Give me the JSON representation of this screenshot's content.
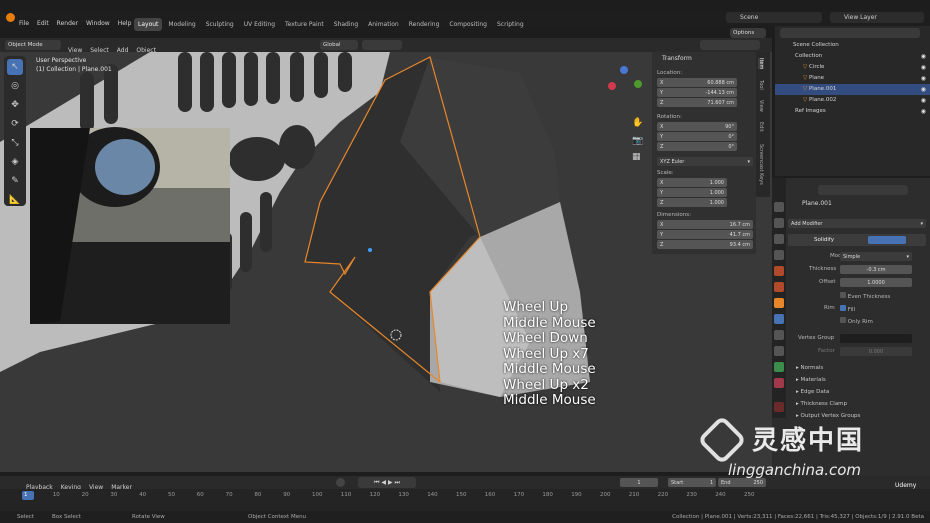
{
  "topbar": {
    "menus": [
      "File",
      "Edit",
      "Render",
      "Window",
      "Help"
    ],
    "workspaces": [
      "Layout",
      "Modeling",
      "Sculpting",
      "UV Editing",
      "Texture Paint",
      "Shading",
      "Animation",
      "Rendering",
      "Compositing",
      "Scripting"
    ],
    "active_workspace": "Layout",
    "scene": "Scene",
    "view_layer": "View Layer"
  },
  "viewport_header": {
    "mode": "Object Mode",
    "menus": [
      "View",
      "Select",
      "Add",
      "Object"
    ],
    "transform_orientation": "Global",
    "options": "Options"
  },
  "viewport_overlay": {
    "perspective": "User Perspective",
    "collection": "(1) Collection | Plane.001"
  },
  "key_log": [
    "Wheel Up",
    "Middle Mouse",
    "Wheel Down",
    "Wheel Up x7",
    "Middle Mouse",
    "Wheel Up x2",
    "Middle Mouse"
  ],
  "n_panel": {
    "title": "Transform",
    "location_label": "Location:",
    "location": [
      {
        "axis": "X",
        "value": "60.888 cm"
      },
      {
        "axis": "Y",
        "value": "-144.13 cm"
      },
      {
        "axis": "Z",
        "value": "71.607 cm"
      }
    ],
    "rotation_label": "Rotation:",
    "rotation": [
      {
        "axis": "X",
        "value": "90°"
      },
      {
        "axis": "Y",
        "value": "0°"
      },
      {
        "axis": "Z",
        "value": "0°"
      }
    ],
    "rotation_mode": "XYZ Euler",
    "scale_label": "Scale:",
    "scale": [
      {
        "axis": "X",
        "value": "1.000"
      },
      {
        "axis": "Y",
        "value": "1.000"
      },
      {
        "axis": "Z",
        "value": "1.000"
      }
    ],
    "dimensions_label": "Dimensions:",
    "dimensions": [
      {
        "axis": "X",
        "value": "16.7 cm"
      },
      {
        "axis": "Y",
        "value": "41.7 cm"
      },
      {
        "axis": "Z",
        "value": "93.4 cm"
      }
    ],
    "tabs": [
      "Item",
      "Tool",
      "View",
      "Edit",
      "Screencast Keys"
    ]
  },
  "outliner": {
    "items": [
      {
        "label": "Scene Collection",
        "indent": 0
      },
      {
        "label": "Collection",
        "indent": 1
      },
      {
        "label": "Circle",
        "indent": 2
      },
      {
        "label": "Plane",
        "indent": 2
      },
      {
        "label": "Plane.001",
        "indent": 2,
        "selected": true
      },
      {
        "label": "Plane.002",
        "indent": 2
      },
      {
        "label": "Ref Images",
        "indent": 1
      }
    ]
  },
  "properties": {
    "object_name": "Plane.001",
    "add_modifier": "Add Modifier",
    "modifier_name": "Solidify",
    "mode_label": "Mode",
    "mode_value": "Simple",
    "thickness_label": "Thickness",
    "thickness_value": "-0.3 cm",
    "offset_label": "Offset",
    "offset_value": "1.0000",
    "even_thickness": "Even Thickness",
    "rim_label": "Rim",
    "fill": "Fill",
    "only_rim": "Only Rim",
    "vertex_group_label": "Vertex Group",
    "factor_label": "Factor",
    "factor_value": "0.000",
    "sections": [
      "Normals",
      "Materials",
      "Edge Data",
      "Thickness Clamp",
      "Output Vertex Groups"
    ]
  },
  "timeline": {
    "menus": [
      "Playback",
      "Keying",
      "View",
      "Marker"
    ],
    "current_frame": "1",
    "start_label": "Start",
    "start": "1",
    "end_label": "End",
    "end": "250",
    "ticks": [
      "1",
      "10",
      "20",
      "30",
      "40",
      "50",
      "60",
      "70",
      "80",
      "90",
      "100",
      "110",
      "120",
      "130",
      "140",
      "150",
      "160",
      "170",
      "180",
      "190",
      "200",
      "210",
      "220",
      "230",
      "240",
      "250"
    ]
  },
  "statusbar": {
    "left": [
      "Select",
      "Box Select",
      "Rotate View",
      "Object Context Menu"
    ],
    "right": "Collection | Plane.001 | Verts:23,311 | Faces:22,661 | Tris:45,327 | Objects:1/9 | 2.91.0 Beta"
  },
  "watermark": {
    "brand": "灵感中国",
    "url": "lingganchina.com",
    "udemy": "Udemy"
  },
  "colors": {
    "accent": "#4772b3",
    "selection": "#ffa633",
    "active_tab": "#444444"
  }
}
